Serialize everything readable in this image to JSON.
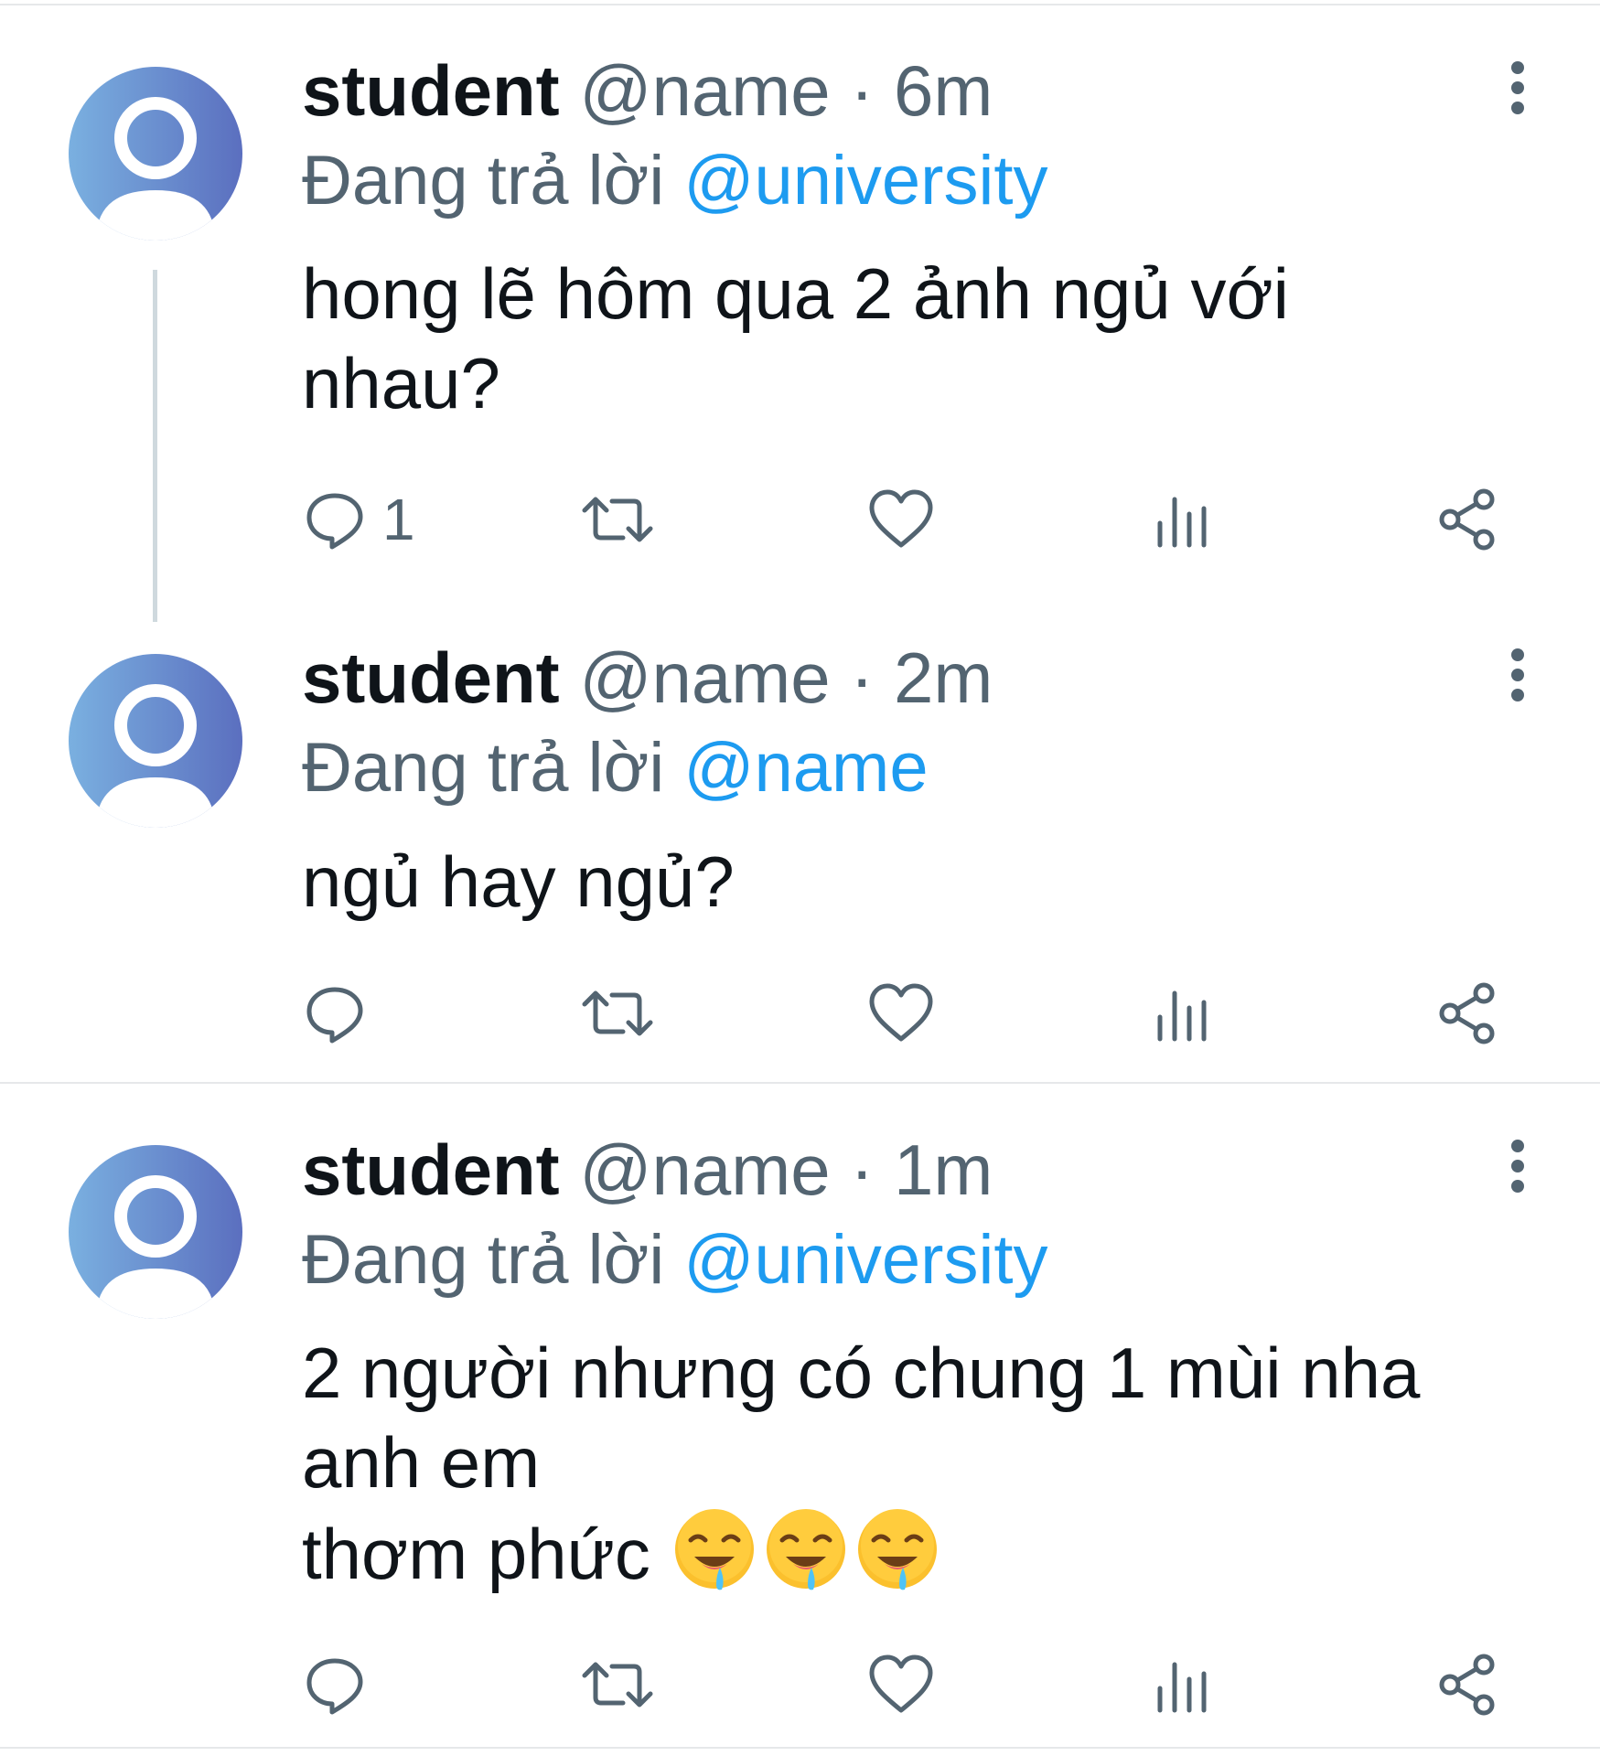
{
  "colors": {
    "accent": "#1d9bf0",
    "secondary_text": "#536471",
    "primary_text": "#0f1419",
    "icon": "#536471",
    "avatar_gradient_start": "#7ab0e0",
    "avatar_gradient_end": "#5b6fbf"
  },
  "tweets": [
    {
      "display_name": "student",
      "handle": "@name",
      "separator": "·",
      "time": "6m",
      "reply_prefix": "Đang trả lời",
      "reply_to": "@university",
      "text_lines": [
        "hong lẽ hôm qua 2 ảnh ngủ với",
        "nhau?"
      ],
      "reply_count": "1",
      "avatar_icon": "default-avatar-icon"
    },
    {
      "display_name": "student",
      "handle": "@name",
      "separator": "·",
      "time": "2m",
      "reply_prefix": "Đang trả lời",
      "reply_to": "@name",
      "text_lines": [
        "ngủ hay ngủ?"
      ],
      "reply_count": "",
      "avatar_icon": "default-avatar-icon"
    },
    {
      "display_name": "student",
      "handle": "@name",
      "separator": "·",
      "time": "1m",
      "reply_prefix": "Đang trả lời",
      "reply_to": "@university",
      "text_lines": [
        "2 người nhưng có chung 1 mùi nha",
        "anh em",
        "thơm phức"
      ],
      "emojis": [
        "drooling-face-emoji",
        "drooling-face-emoji",
        "drooling-face-emoji"
      ],
      "reply_count": "",
      "avatar_icon": "default-avatar-icon"
    }
  ],
  "action_icons": [
    "reply-icon",
    "retweet-icon",
    "like-icon",
    "analytics-icon",
    "share-icon"
  ],
  "menu_icon": "more-vertical-icon"
}
